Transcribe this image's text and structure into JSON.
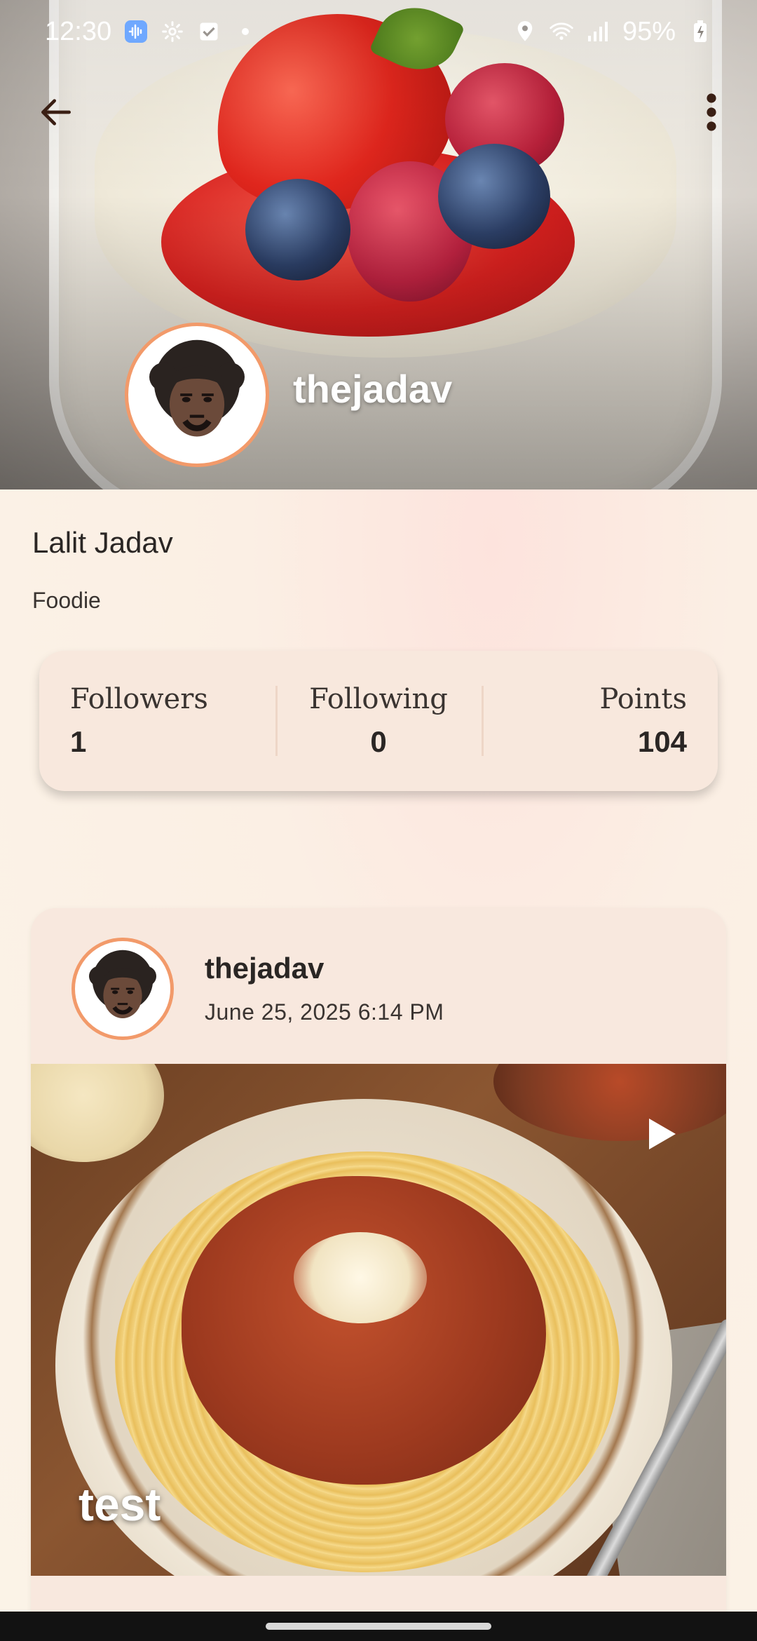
{
  "status_bar": {
    "time": "12:30",
    "battery": "95%",
    "left_icons": [
      "sound-wave-icon",
      "settings-gear-icon",
      "checkbox-icon",
      "dot-icon"
    ],
    "right_icons": [
      "location-pin-icon",
      "wifi-icon",
      "signal-icon",
      "battery-charging-icon"
    ]
  },
  "header": {
    "back_icon": "arrow-left-icon",
    "menu_icon": "more-vertical-icon",
    "username": "thejadav"
  },
  "profile": {
    "full_name": "Lalit Jadav",
    "bio": "Foodie",
    "stats": [
      {
        "label": "Followers",
        "value": "1"
      },
      {
        "label": "Following",
        "value": "0"
      },
      {
        "label": "Points",
        "value": "104"
      }
    ]
  },
  "post": {
    "username": "thejadav",
    "date": "June 25, 2025 6:14 PM",
    "caption": "test",
    "media_type": "video",
    "play_icon": "play-icon"
  },
  "colors": {
    "accent_ring": "#f29a6a",
    "card_bg": "#f8e8de",
    "page_bg": "#fbf1e6"
  }
}
